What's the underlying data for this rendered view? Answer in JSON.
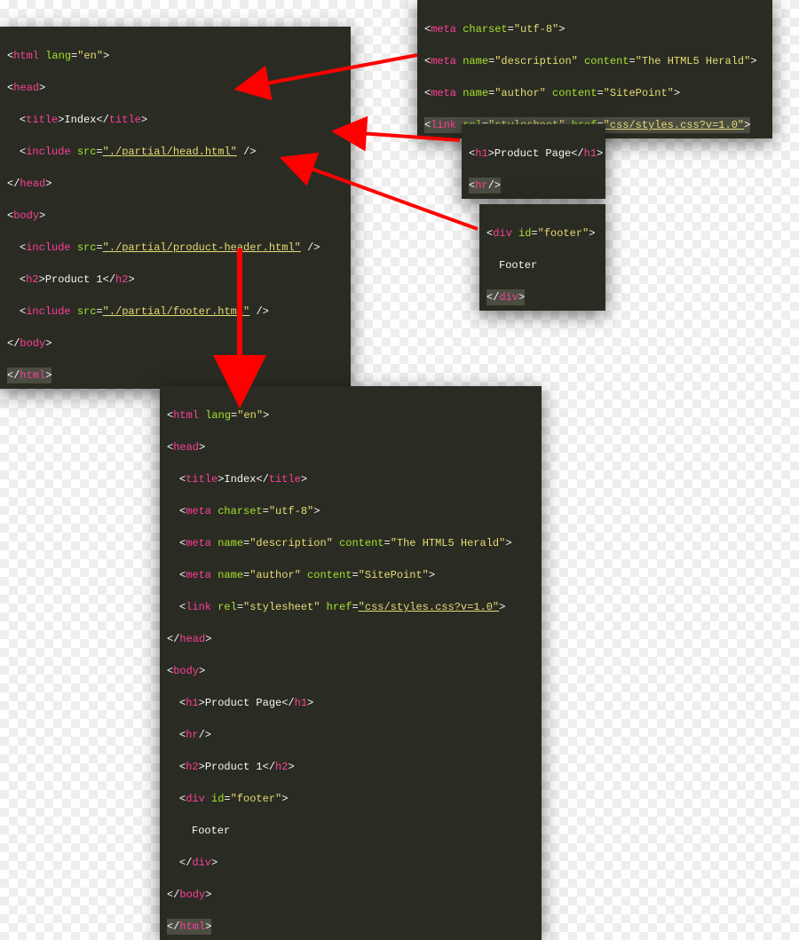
{
  "main": {
    "l0": {
      "p": "<",
      "t": "html ",
      "a": "lang",
      "e": "=",
      "v": "\"en\"",
      "c": ">"
    },
    "l1": {
      "p": "<",
      "t": "head",
      "c": ">"
    },
    "l2": {
      "p": "<",
      "t": "title",
      "c": ">",
      "txt": "Index",
      "p2": "</",
      "t2": "title",
      "c2": ">"
    },
    "l3": {
      "p": "<",
      "t": "include ",
      "a": "src",
      "e": "=",
      "v": "\"./partial/head.html\"",
      "sp": " ",
      "sl": "/>"
    },
    "l4": {
      "p": "</",
      "t": "head",
      "c": ">"
    },
    "l5": {
      "p": "<",
      "t": "body",
      "c": ">"
    },
    "l6": {
      "p": "<",
      "t": "include ",
      "a": "src",
      "e": "=",
      "v": "\"./partial/product-header.html\"",
      "sp": " ",
      "sl": "/>"
    },
    "l7": {
      "p": "<",
      "t": "h2",
      "c": ">",
      "txt": "Product 1",
      "p2": "</",
      "t2": "h2",
      "c2": ">"
    },
    "l8": {
      "p": "<",
      "t": "include ",
      "a": "src",
      "e": "=",
      "v": "\"./partial/footer.html\"",
      "sp": " ",
      "sl": "/>"
    },
    "l9": {
      "p": "</",
      "t": "body",
      "c": ">"
    },
    "l10": {
      "p": "</",
      "t": "html",
      "c": ">"
    }
  },
  "head_partial": {
    "l0": {
      "p": "<",
      "t": "meta ",
      "a": "charset",
      "e": "=",
      "v": "\"utf-8\"",
      "c": ">"
    },
    "l1": {
      "p": "<",
      "t": "meta ",
      "a1": "name",
      "e1": "=",
      "v1": "\"description\"",
      "sp": " ",
      "a2": "content",
      "e2": "=",
      "v2": "\"The HTML5 Herald\"",
      "c": ">"
    },
    "l2": {
      "p": "<",
      "t": "meta ",
      "a1": "name",
      "e1": "=",
      "v1": "\"author\"",
      "sp": " ",
      "a2": "content",
      "e2": "=",
      "v2": "\"SitePoint\"",
      "c": ">"
    },
    "l3": {
      "p": "<",
      "t": "link ",
      "a1": "rel",
      "e1": "=",
      "v1": "\"stylesheet\"",
      "sp": " ",
      "a2": "href",
      "e2": "=",
      "v2": "\"css/styles.css?v=1.0\"",
      "c": ">"
    }
  },
  "header_partial": {
    "l0": {
      "p": "<",
      "t": "h1",
      "c": ">",
      "txt": "Product Page",
      "p2": "</",
      "t2": "h1",
      "c2": ">"
    },
    "l1": {
      "p": "<",
      "t": "hr",
      "sl": "/>"
    }
  },
  "footer_partial": {
    "l0": {
      "p": "<",
      "t": "div ",
      "a": "id",
      "e": "=",
      "v": "\"footer\"",
      "c": ">"
    },
    "l1": {
      "txt": "Footer"
    },
    "l2": {
      "p": "</",
      "t": "div",
      "c": ">"
    }
  },
  "result": {
    "l0": {
      "p": "<",
      "t": "html ",
      "a": "lang",
      "e": "=",
      "v": "\"en\"",
      "c": ">"
    },
    "l1": {
      "p": "<",
      "t": "head",
      "c": ">"
    },
    "l2": {
      "p": "<",
      "t": "title",
      "c": ">",
      "txt": "Index",
      "p2": "</",
      "t2": "title",
      "c2": ">"
    },
    "l3": {
      "p": "<",
      "t": "meta ",
      "a": "charset",
      "e": "=",
      "v": "\"utf-8\"",
      "c": ">"
    },
    "l4": {
      "p": "<",
      "t": "meta ",
      "a1": "name",
      "e1": "=",
      "v1": "\"description\"",
      "sp": " ",
      "a2": "content",
      "e2": "=",
      "v2": "\"The HTML5 Herald\"",
      "c": ">"
    },
    "l5": {
      "p": "<",
      "t": "meta ",
      "a1": "name",
      "e1": "=",
      "v1": "\"author\"",
      "sp": " ",
      "a2": "content",
      "e2": "=",
      "v2": "\"SitePoint\"",
      "c": ">"
    },
    "l6": {
      "p": "<",
      "t": "link ",
      "a1": "rel",
      "e1": "=",
      "v1": "\"stylesheet\"",
      "sp": " ",
      "a2": "href",
      "e2": "=",
      "v2": "\"css/styles.css?v=1.0\"",
      "c": ">"
    },
    "l7": {
      "p": "</",
      "t": "head",
      "c": ">"
    },
    "l8": {
      "p": "<",
      "t": "body",
      "c": ">"
    },
    "l9": {
      "p": "<",
      "t": "h1",
      "c": ">",
      "txt": "Product Page",
      "p2": "</",
      "t2": "h1",
      "c2": ">"
    },
    "l10": {
      "p": "<",
      "t": "hr",
      "sl": "/>"
    },
    "l11": {
      "p": "<",
      "t": "h2",
      "c": ">",
      "txt": "Product 1",
      "p2": "</",
      "t2": "h2",
      "c2": ">"
    },
    "l12": {
      "p": "<",
      "t": "div ",
      "a": "id",
      "e": "=",
      "v": "\"footer\"",
      "c": ">"
    },
    "l13": {
      "txt": "Footer"
    },
    "l14": {
      "p": "</",
      "t": "div",
      "c": ">"
    },
    "l15": {
      "p": "</",
      "t": "body",
      "c": ">"
    },
    "l16": {
      "p": "</",
      "t": "html",
      "c": ">"
    }
  }
}
